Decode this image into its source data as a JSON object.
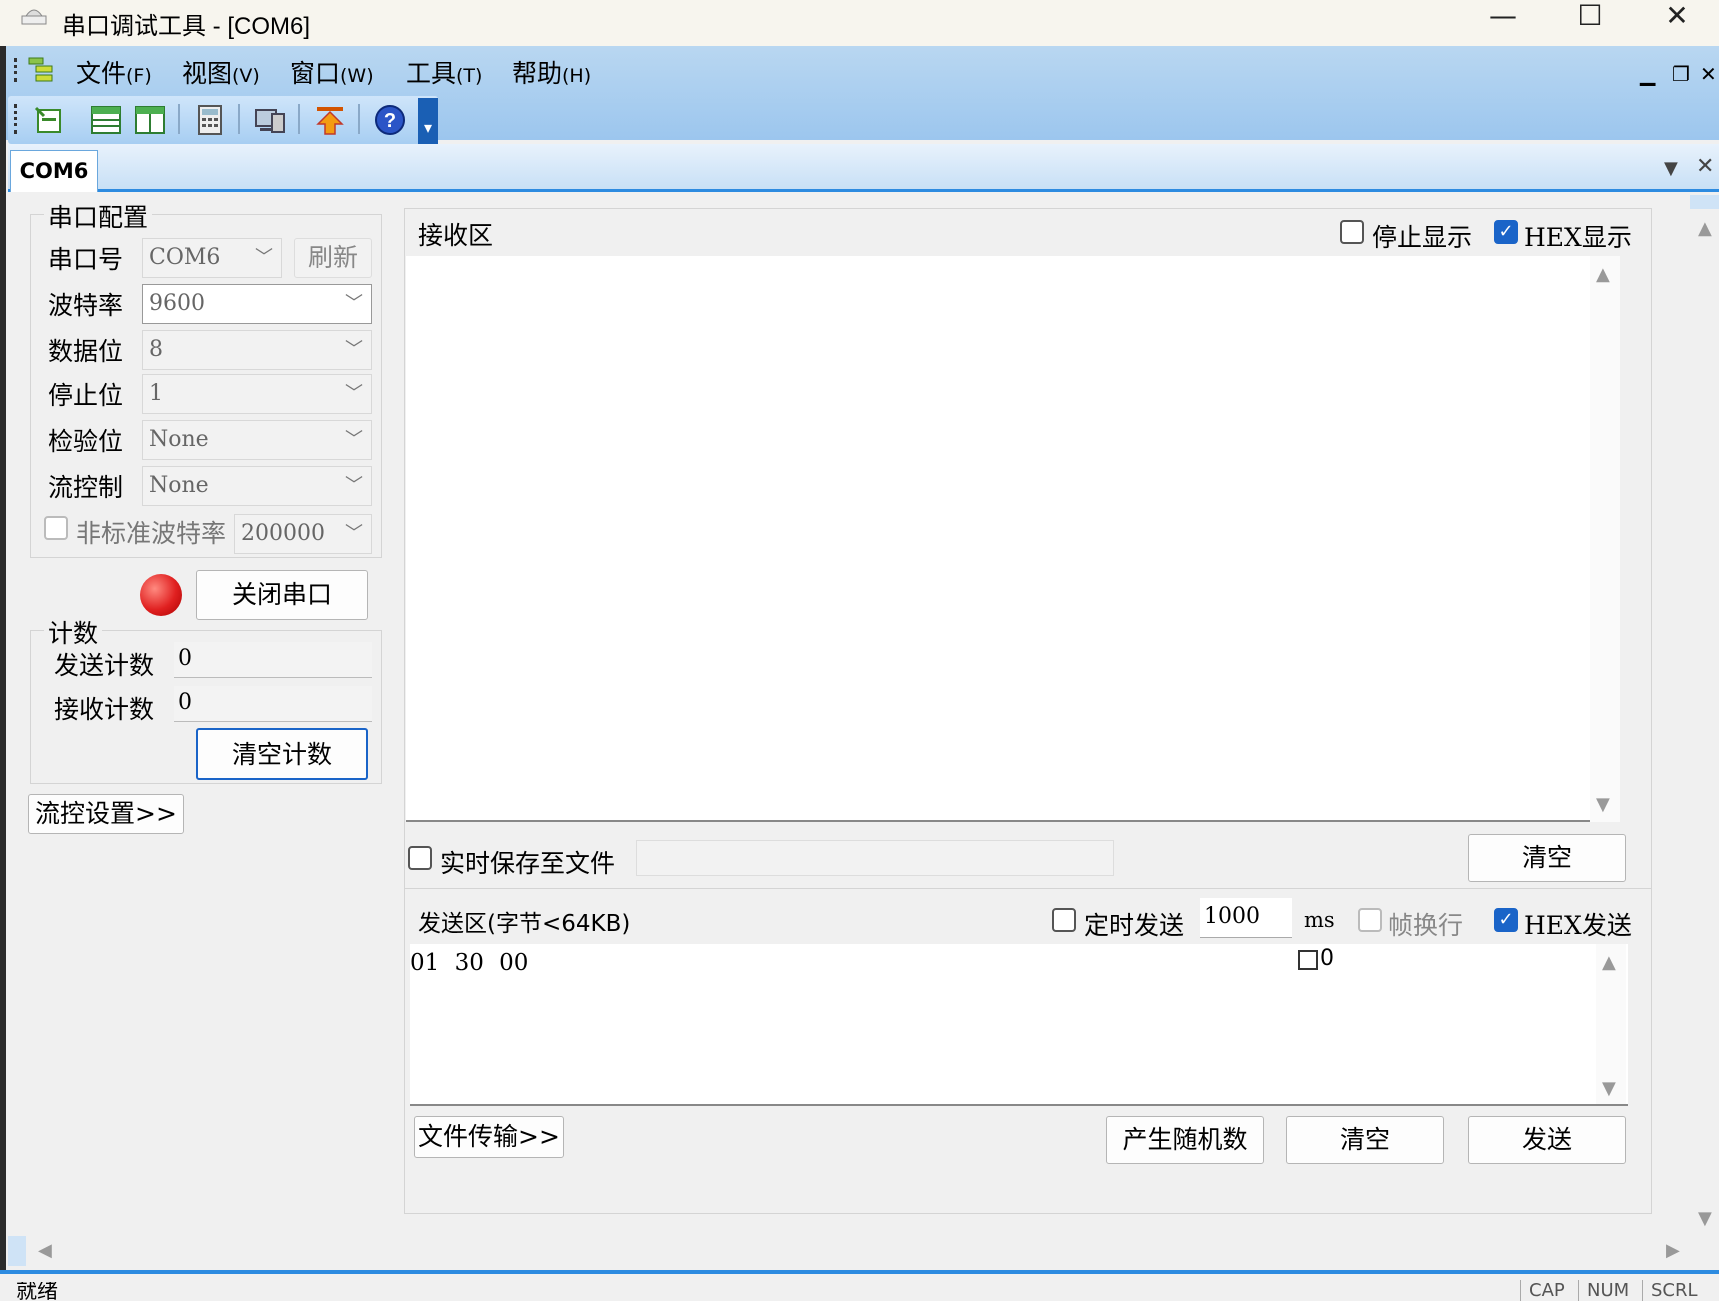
{
  "window": {
    "title": "串口调试工具 - [COM6]",
    "minimize": "—",
    "maximize": "☐",
    "close": "✕"
  },
  "menu": {
    "items": [
      {
        "label": "文件",
        "key": "(F)"
      },
      {
        "label": "视图",
        "key": "(V)"
      },
      {
        "label": "窗口",
        "key": "(W)"
      },
      {
        "label": "工具",
        "key": "(T)"
      },
      {
        "label": "帮助",
        "key": "(H)"
      }
    ],
    "mdi_min": "▁",
    "mdi_restore": "❐",
    "mdi_close": "✕"
  },
  "toolbar": {
    "icons": [
      "new-document-icon",
      "horizontal-layout-icon",
      "vertical-layout-icon",
      "calculator-icon",
      "computer-icon",
      "upload-icon",
      "help-icon"
    ],
    "overflow": "▾"
  },
  "tab": {
    "label": "COM6",
    "menu_arrow": "▼",
    "close": "✕"
  },
  "config": {
    "legend": "串口配置",
    "port_label": "串口号",
    "port_value": "COM6",
    "refresh": "刷新",
    "baud_label": "波特率",
    "baud_value": "9600",
    "databits_label": "数据位",
    "databits_value": "8",
    "stopbits_label": "停止位",
    "stopbits_value": "1",
    "parity_label": "检验位",
    "parity_value": "None",
    "flow_label": "流控制",
    "flow_value": "None",
    "nonstd_label": "非标准波特率",
    "nonstd_value": "200000",
    "close_port": "关闭串口",
    "status_color": "#e02020"
  },
  "count": {
    "legend": "计数",
    "sent_label": "发送计数",
    "sent_value": "0",
    "recv_label": "接收计数",
    "recv_value": "0",
    "clear": "清空计数"
  },
  "flow_settings": "流控设置>>",
  "receive": {
    "title": "接收区",
    "stop_display": "停止显示",
    "stop_display_checked": false,
    "hex_display": "HEX显示",
    "hex_display_checked": true,
    "save_to_file": "实时保存至文件",
    "clear": "清空"
  },
  "send": {
    "title": "发送区(字节<64KB)",
    "timed_send": "定时发送",
    "interval": "1000",
    "unit": "ms",
    "frame_newline": "帧换行",
    "hex_send": "HEX发送",
    "hex_send_checked": true,
    "content": "01 30 00",
    "marker_text": "0",
    "file_transfer": "文件传输>>",
    "random": "产生随机数",
    "clear": "清空",
    "send": "发送"
  },
  "status": {
    "text": "就绪",
    "cap": "CAP",
    "num": "NUM",
    "scrl": "SCRL"
  }
}
